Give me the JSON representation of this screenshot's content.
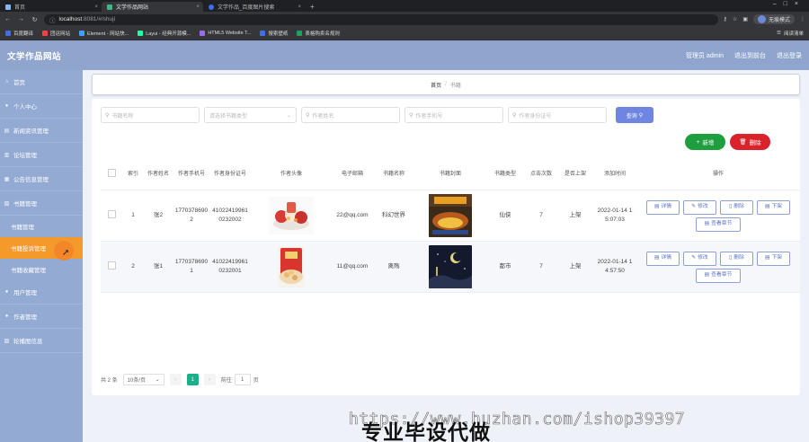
{
  "browser": {
    "tabs": [
      {
        "label": "首页",
        "active": false
      },
      {
        "label": "文学作品网站",
        "active": true
      },
      {
        "label": "文学作品_百度图片搜索",
        "active": false
      }
    ],
    "new_tab": "+",
    "address": {
      "host": "localhost",
      "rest": ":8081/#/shuji"
    },
    "guest_label": "无痕模式",
    "bookmarks": [
      "百度翻译",
      "团运网站",
      "Element - 网站快...",
      "Layui - 经典开源模...",
      "HTML5 Website T...",
      "搜索壁纸",
      "表格购卖名规则"
    ],
    "reading_list": "阅读清单"
  },
  "header": {
    "title": "文学作品网站",
    "links": [
      "管理员 admin",
      "退出到前台",
      "退出登录"
    ]
  },
  "sidebar": {
    "items": [
      {
        "label": "首页",
        "icon": "home-icon"
      },
      {
        "label": "个人中心",
        "icon": "user-icon"
      },
      {
        "label": "新闻资讯管理",
        "icon": "news-icon"
      },
      {
        "label": "论坛管理",
        "icon": "forum-icon"
      },
      {
        "label": "公告信息管理",
        "icon": "notice-icon"
      },
      {
        "label": "书籍管理",
        "icon": "book-icon"
      }
    ],
    "sub_items": [
      {
        "label": "书籍管理",
        "active": false
      },
      {
        "label": "书籍投诉管理",
        "active": true
      },
      {
        "label": "书籍收藏管理",
        "active": false
      }
    ],
    "items_after": [
      {
        "label": "用户管理",
        "icon": "users-icon"
      },
      {
        "label": "作者管理",
        "icon": "author-icon"
      },
      {
        "label": "轮播图信息",
        "icon": "carousel-icon"
      }
    ]
  },
  "breadcrumb": {
    "home": "首页",
    "sep": "/",
    "current": "书籍"
  },
  "filters": {
    "book_name_ph": "书籍名称",
    "book_type_ph": "请选择书籍类型",
    "author_name_ph": "作者姓名",
    "author_phone_ph": "作者手机号",
    "author_id_ph": "作者身份证号",
    "search_label": "查询"
  },
  "actions": {
    "add_label": "新增",
    "delete_label": "删除"
  },
  "table": {
    "headers": [
      "索引",
      "作者姓名",
      "作者手机号",
      "作者身份证号",
      "作者头像",
      "电子邮箱",
      "书籍名称",
      "书籍封面",
      "书籍类型",
      "点击次数",
      "是否上架",
      "添加时间",
      "操作"
    ],
    "rows": [
      {
        "index": "1",
        "name": "张2",
        "phone": "17703786902",
        "idcard": "410224199610232002",
        "email": "22@qq.com",
        "book_name": "科幻世界",
        "book_type": "仙侠",
        "clicks": "7",
        "on_shelf": "上架",
        "time": "2022-01-14 15:07:03"
      },
      {
        "index": "2",
        "name": "张1",
        "phone": "17703786901",
        "idcard": "410224199610232001",
        "email": "11@qq.com",
        "book_name": "离殇",
        "book_type": "都市",
        "clicks": "7",
        "on_shelf": "上架",
        "time": "2022-01-14 14:57:50"
      }
    ],
    "op_labels": {
      "detail": "详情",
      "edit": "修改",
      "delete": "删除",
      "offshelf": "下架",
      "chapters": "查看章节"
    }
  },
  "pagination": {
    "total": "共 2 条",
    "page_size": "10条/页",
    "prev": "‹",
    "current": "1",
    "next": "›",
    "goto_prefix": "前往",
    "goto_value": "1",
    "goto_suffix": "页"
  },
  "watermark": {
    "url": "https://www.huzhan.com/ishop39397",
    "text": "专业毕设代做"
  }
}
